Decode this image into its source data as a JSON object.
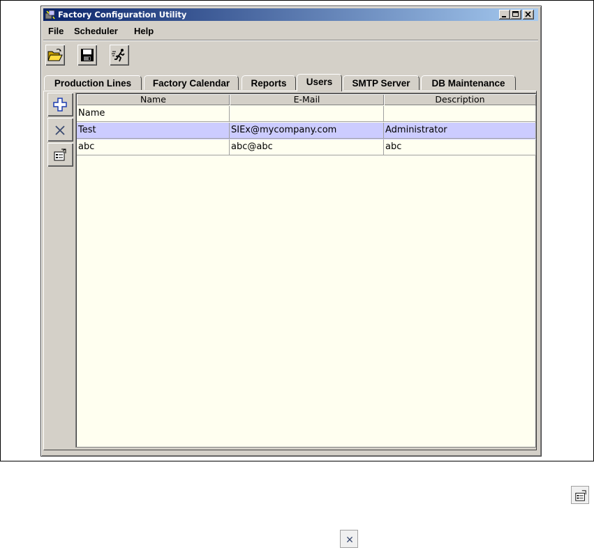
{
  "window": {
    "title": "Factory Configuration Utility"
  },
  "menu": [
    {
      "label": "File"
    },
    {
      "label": "Scheduler"
    },
    {
      "label": "Help"
    }
  ],
  "tabs": [
    {
      "label": "Production Lines"
    },
    {
      "label": "Factory Calendar"
    },
    {
      "label": "Reports"
    },
    {
      "label": "Users",
      "active": true
    },
    {
      "label": "SMTP Server"
    },
    {
      "label": "DB Maintenance"
    }
  ],
  "table": {
    "headers": [
      "Name",
      "E-Mail",
      "Description"
    ],
    "rows": [
      [
        "Name",
        "",
        ""
      ],
      [
        "Test",
        "SIEx@mycompany.com",
        "Administrator"
      ],
      [
        "abc",
        "abc@abc",
        "abc"
      ]
    ],
    "selected_row": 1
  },
  "icons": {
    "open": "folder-open-icon",
    "save": "floppy-disk-icon",
    "run": "running-man-icon",
    "add": "plus-icon",
    "delete": "x-icon",
    "properties": "properties-icon"
  },
  "colors": {
    "title_bar_start": "#0a246a",
    "title_bar_end": "#a6caf0",
    "selection": "#ccccff",
    "table_bg": "#fffff0"
  }
}
